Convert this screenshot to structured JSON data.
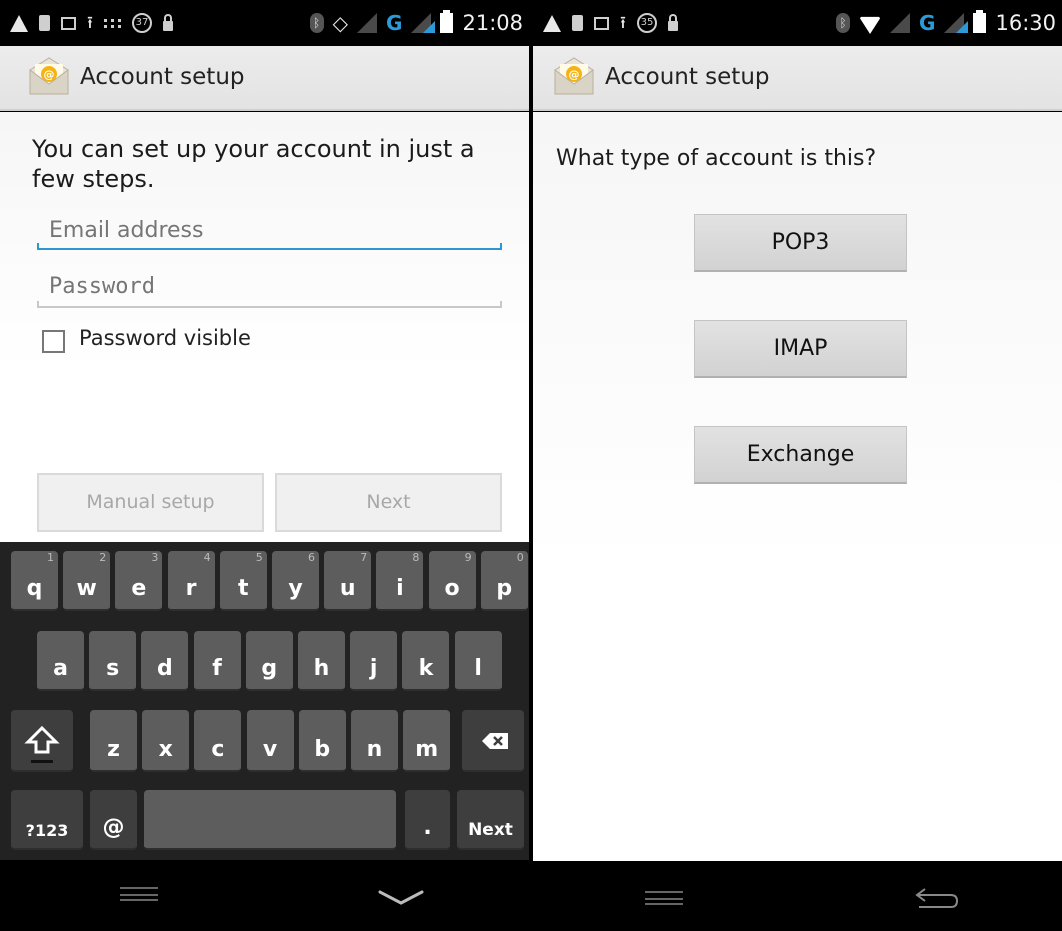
{
  "left": {
    "status_time": "21:08",
    "status_badge": "37",
    "title": "Account setup",
    "prompt": "You can set up your account in just a few steps.",
    "email_placeholder": "Email address",
    "password_placeholder": "Password",
    "password_visible_label": "Password visible",
    "manual_setup_label": "Manual setup",
    "next_label": "Next",
    "keyboard": {
      "row1": [
        {
          "k": "q",
          "n": "1"
        },
        {
          "k": "w",
          "n": "2"
        },
        {
          "k": "e",
          "n": "3"
        },
        {
          "k": "r",
          "n": "4"
        },
        {
          "k": "t",
          "n": "5"
        },
        {
          "k": "y",
          "n": "6"
        },
        {
          "k": "u",
          "n": "7"
        },
        {
          "k": "i",
          "n": "8"
        },
        {
          "k": "o",
          "n": "9"
        },
        {
          "k": "p",
          "n": "0"
        }
      ],
      "row2": [
        "a",
        "s",
        "d",
        "f",
        "g",
        "h",
        "j",
        "k",
        "l"
      ],
      "row3": [
        "z",
        "x",
        "c",
        "v",
        "b",
        "n",
        "m"
      ],
      "symbols_label": "?123",
      "at_label": "@",
      "period_label": ".",
      "action_label": "Next"
    }
  },
  "right": {
    "status_time": "16:30",
    "status_badge": "35",
    "title": "Account setup",
    "question": "What type of account is this?",
    "options": [
      "POP3",
      "IMAP",
      "Exchange"
    ]
  },
  "colors": {
    "accent": "#2f97d0",
    "signal_blue": "#2c9ad8",
    "keyboard_bg": "#222222",
    "key": "#5d5d5d"
  }
}
